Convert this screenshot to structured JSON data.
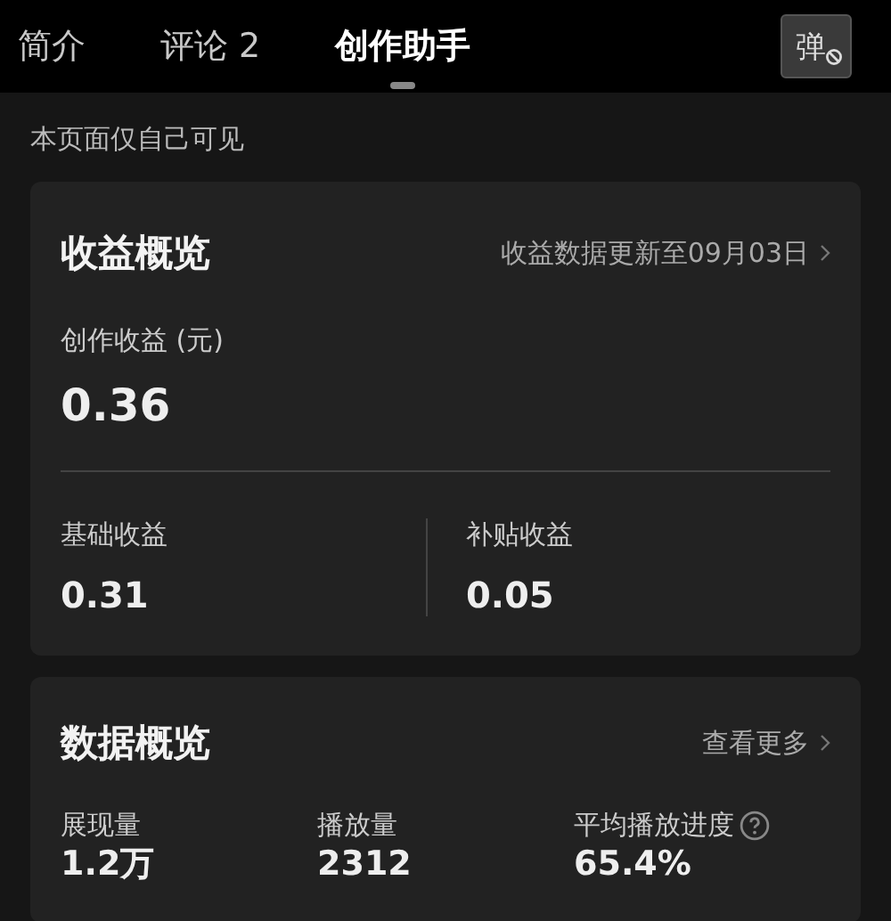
{
  "tabs": [
    {
      "label": "简介",
      "selected": false
    },
    {
      "label": "评论 2",
      "selected": false
    },
    {
      "label": "创作助手",
      "selected": true
    }
  ],
  "danmaku_button": {
    "label": "弹"
  },
  "notice": "本页面仅自己可见",
  "earnings": {
    "title": "收益概览",
    "update_link": "收益数据更新至09月03日",
    "total_label": "创作收益 (元)",
    "total_value": "0.36",
    "items": [
      {
        "label": "基础收益",
        "value": "0.31"
      },
      {
        "label": "补贴收益",
        "value": "0.05"
      }
    ]
  },
  "data_overview": {
    "title": "数据概览",
    "more_link": "查看更多",
    "metrics": [
      {
        "label": "展现量",
        "value": "1.2万",
        "help": false
      },
      {
        "label": "播放量",
        "value": "2312",
        "help": false
      },
      {
        "label": "平均播放进度",
        "value": "65.4%",
        "help": true
      }
    ]
  }
}
